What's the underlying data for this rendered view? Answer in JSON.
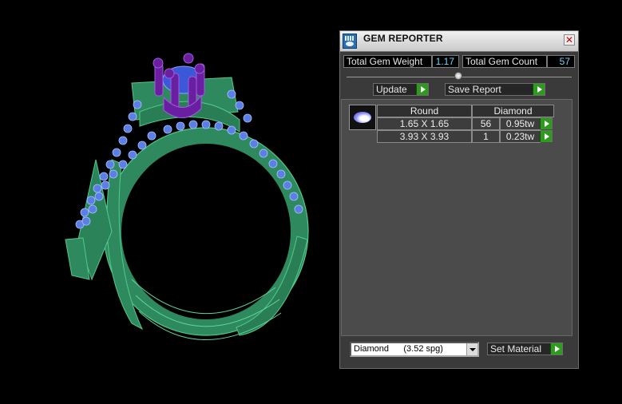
{
  "panel": {
    "title": "GEM REPORTER",
    "close_glyph": "✕",
    "total_weight_label": "Total Gem Weight",
    "total_weight_value": "1.17",
    "total_count_label": "Total Gem Count",
    "total_count_value": "57",
    "update_label": "Update",
    "save_label": "Save Report",
    "table": {
      "headers": [
        "Round",
        "Diamond"
      ],
      "rows": [
        {
          "size": "1.65 X 1.65",
          "count": "56",
          "weight": "0.95tw"
        },
        {
          "size": "3.93 X 3.93",
          "count": "1",
          "weight": "0.23tw"
        }
      ]
    },
    "material_select_value": "Diamond      (3.52 spg)",
    "set_material_label": "Set Material"
  },
  "colors": {
    "ring_green": "#2e8a5e",
    "gem_blue": "#5b7fe6",
    "prong_purple": "#6a1fa0",
    "value_cyan": "#6fd6ff",
    "play_green": "#2e9a1e"
  },
  "icons": {
    "app": "gem-reporter-icon",
    "close": "close-icon",
    "play": "play-arrow-icon",
    "dropdown": "chevron-down-icon",
    "gem": "round-gem-icon"
  }
}
